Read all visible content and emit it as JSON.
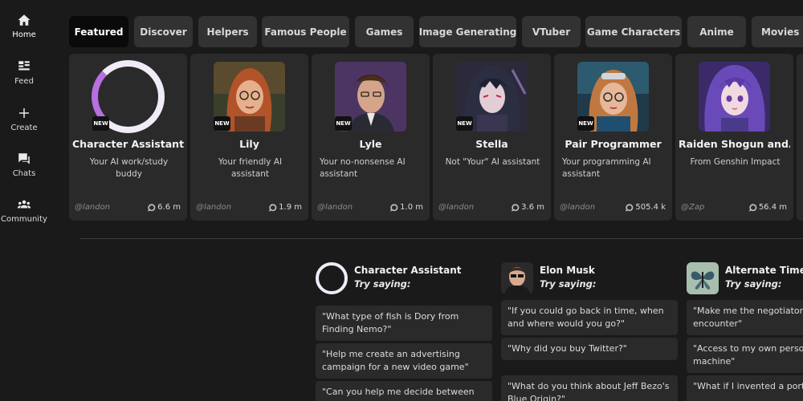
{
  "sidebar": {
    "items": [
      {
        "label": "Home",
        "icon": "home-icon"
      },
      {
        "label": "Feed",
        "icon": "feed-icon"
      },
      {
        "label": "Create",
        "icon": "plus-icon"
      },
      {
        "label": "Chats",
        "icon": "chat-icon"
      },
      {
        "label": "Community",
        "icon": "community-icon"
      }
    ]
  },
  "tabs": [
    {
      "label": "Featured"
    },
    {
      "label": "Discover"
    },
    {
      "label": "Helpers"
    },
    {
      "label": "Famous People"
    },
    {
      "label": "Games"
    },
    {
      "label": "Image Generating"
    },
    {
      "label": "VTuber"
    },
    {
      "label": "Game Characters"
    },
    {
      "label": "Anime"
    },
    {
      "label": "Movies & TV"
    }
  ],
  "badge_text": "NEW",
  "cards": [
    {
      "name": "Character Assistant",
      "desc": "Your AI work/study buddy",
      "author": "@landon",
      "count": "6.6 m"
    },
    {
      "name": "Lily",
      "desc": "Your friendly AI assistant",
      "author": "@landon",
      "count": "1.9 m"
    },
    {
      "name": "Lyle",
      "desc": "Your no-nonsense AI assistant",
      "author": "@landon",
      "count": "1.0 m"
    },
    {
      "name": "Stella",
      "desc": "Not \"Your\" AI assistant",
      "author": "@landon",
      "count": "3.6 m"
    },
    {
      "name": "Pair Programmer",
      "desc": "Your programming AI assistant",
      "author": "@landon",
      "count": "505.4 k"
    },
    {
      "name": "Raiden Shogun and…",
      "desc": "From Genshin Impact",
      "author": "@Zap",
      "count": "56.4 m"
    }
  ],
  "suggestions": [
    {
      "name": "Character Assistant",
      "try": "Try saying:",
      "prompts": [
        "\"What type of fish is Dory from Finding Nemo?\"",
        "\"Help me create an advertising campaign for a new video game\"",
        "\"Can you help me decide between the"
      ]
    },
    {
      "name": "Elon Musk",
      "try": "Try saying:",
      "prompts": [
        "\"If you could go back in time, when and where would you go?\"",
        "\"Why did you buy Twitter?\"",
        "\"What do you think about Jeff Bezo's Blue Origin?\""
      ]
    },
    {
      "name": "Alternate Timeline",
      "try": "Try saying:",
      "prompts": [
        "\"Make me the negotiator for an alien encounter\"",
        "\"Access to my own personal time machine\"",
        "\"What if I invented a portal gun?\""
      ]
    }
  ]
}
